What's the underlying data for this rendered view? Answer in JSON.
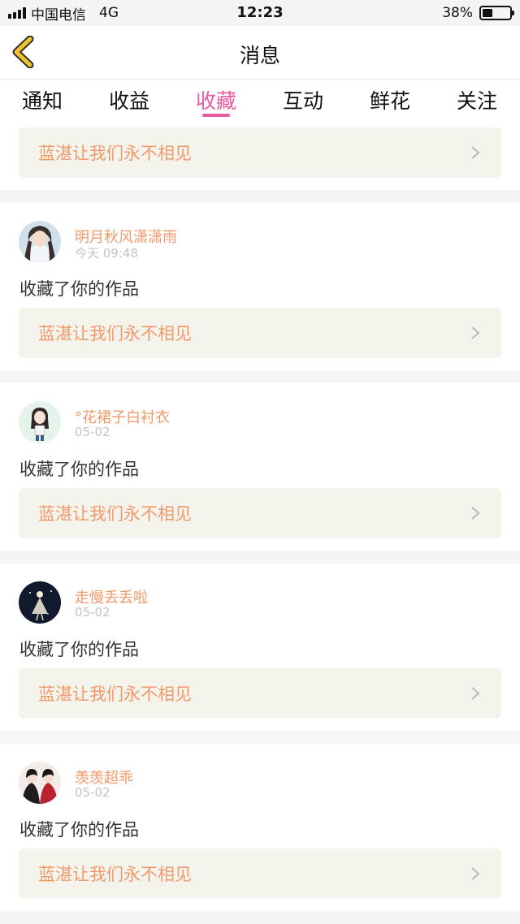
{
  "status_bar": {
    "carrier": "中国电信",
    "network": "4G",
    "time": "12:23",
    "battery": "38%",
    "battery_level": 0.38
  },
  "nav": {
    "title": "消息",
    "back_icon": "chevron-left-icon"
  },
  "tabs": [
    {
      "label": "通知"
    },
    {
      "label": "收益"
    },
    {
      "label": "收藏",
      "active": true
    },
    {
      "label": "互动"
    },
    {
      "label": "鲜花"
    },
    {
      "label": "关注"
    }
  ],
  "top_work": {
    "title": "蓝湛让我们永不相见"
  },
  "messages": [
    {
      "username": "明月秋风潇潇雨",
      "time": "今天 09:48",
      "action": "收藏了你的作品",
      "work_title": "蓝湛让我们永不相见"
    },
    {
      "username": "°花裙子白衬衣",
      "time": "05-02",
      "action": "收藏了你的作品",
      "work_title": "蓝湛让我们永不相见"
    },
    {
      "username": "走慢丢丢啦",
      "time": "05-02",
      "action": "收藏了你的作品",
      "work_title": "蓝湛让我们永不相见"
    },
    {
      "username": "羡羡超乖",
      "time": "05-02",
      "action": "收藏了你的作品",
      "work_title": "蓝湛让我们永不相见"
    }
  ],
  "colors": {
    "accent": "#e75ca1",
    "username": "#f09a6c",
    "card_bg": "#f4f4ec",
    "back_icon": "#f2c12e"
  }
}
